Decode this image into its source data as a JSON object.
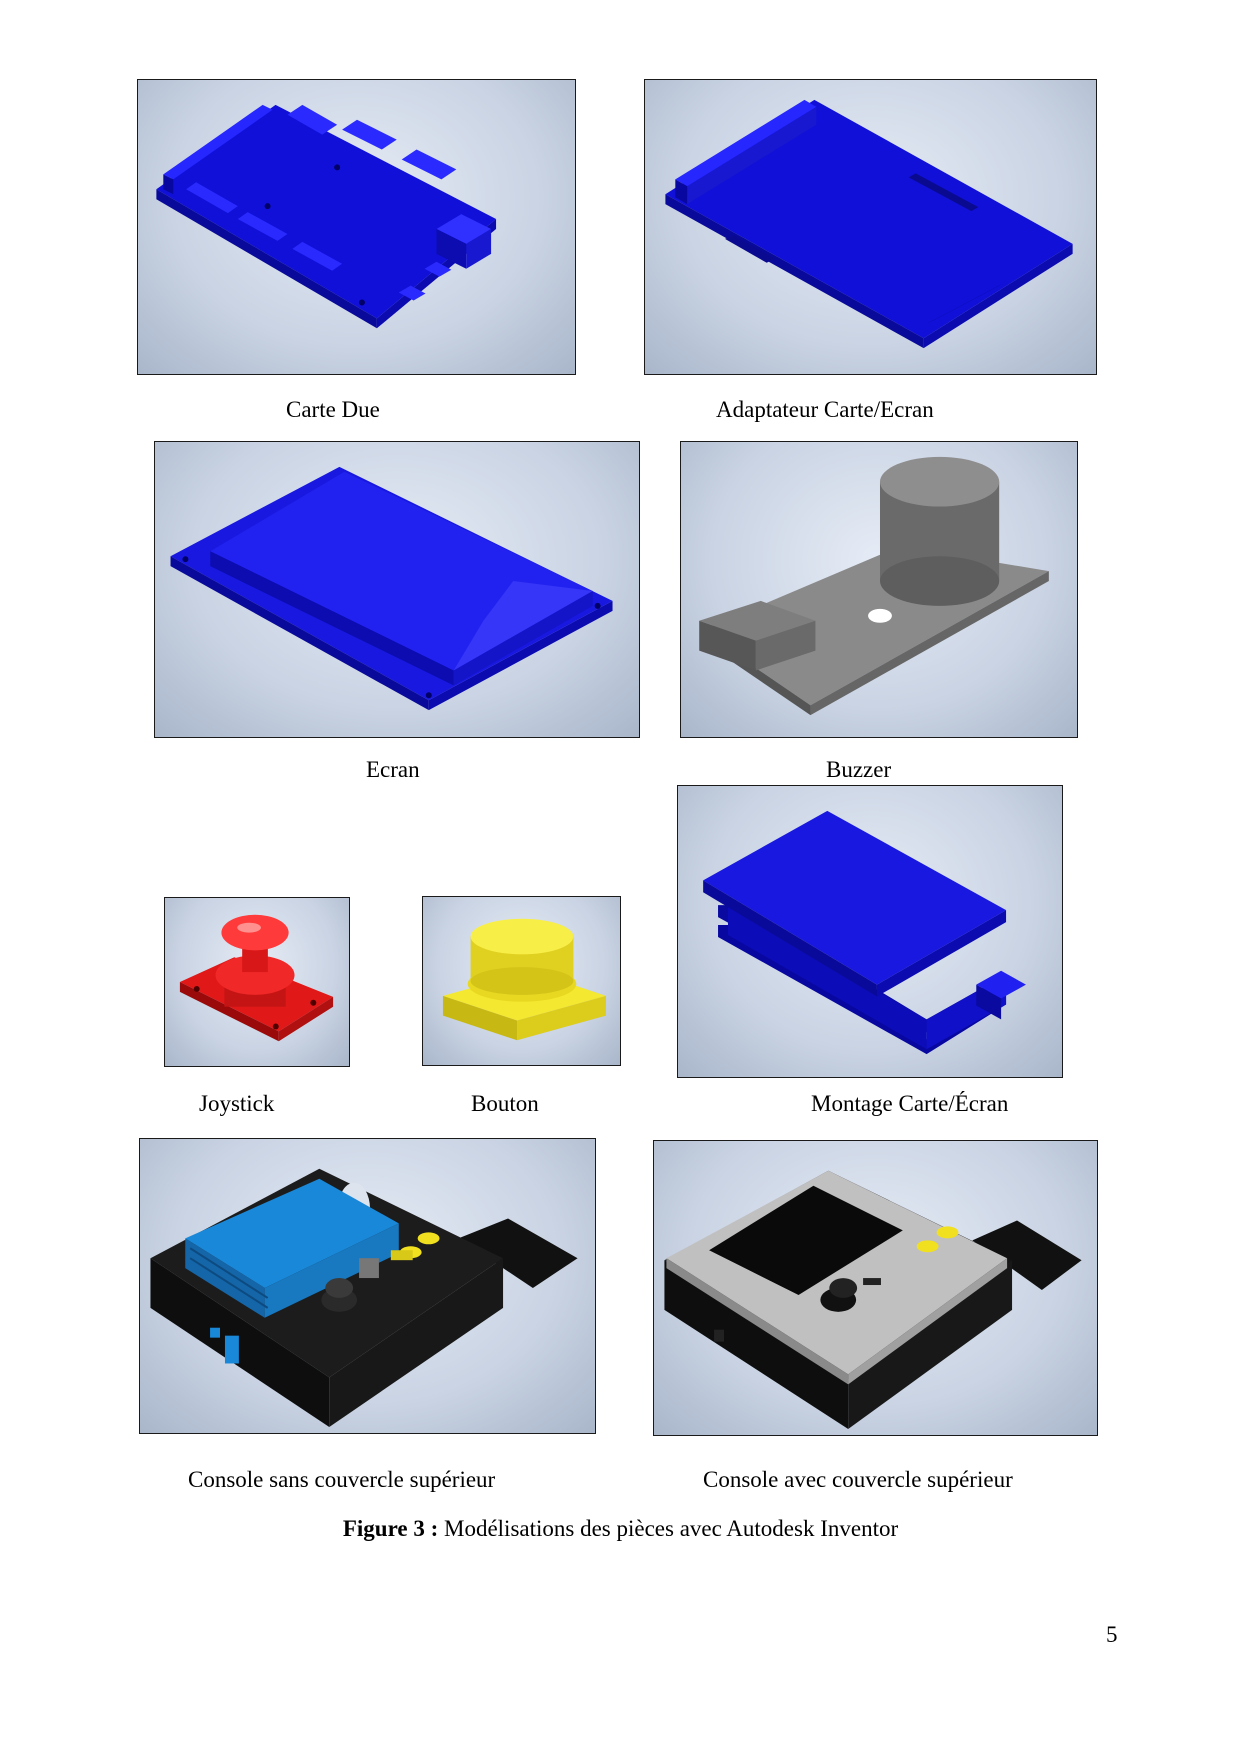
{
  "captions": {
    "carte_due": "Carte Due",
    "adaptateur": "Adaptateur Carte/Ecran",
    "ecran": "Ecran",
    "buzzer": "Buzzer",
    "joystick": "Joystick",
    "bouton": "Bouton",
    "montage": "Montage Carte/Écran",
    "console_sans": "Console sans couvercle supérieur",
    "console_avec": "Console avec couvercle supérieur"
  },
  "figure": {
    "label": "Figure 3 :",
    "text": " Modélisations des pièces avec Autodesk Inventor"
  },
  "page_number": "5",
  "colors": {
    "board_blue": "#1414e6",
    "buzzer_gray": "#777777",
    "joystick_red": "#e81818",
    "button_yellow": "#f0e020",
    "shield_blue": "#1478c8",
    "case_black": "#151515",
    "lid_gray": "#b4b4b4"
  }
}
